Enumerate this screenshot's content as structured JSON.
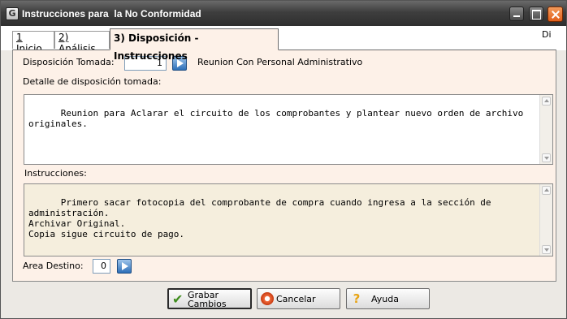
{
  "window": {
    "title": "Instrucciones para  la No Conformidad",
    "app_icon_glyph": "G"
  },
  "tabs": [
    {
      "number": "1",
      "label": "Inicio"
    },
    {
      "number": "2)",
      "label": "Análisis"
    },
    {
      "number": "3)",
      "label": "Disposición - Instrucciones"
    }
  ],
  "top_right_label": "Di",
  "form": {
    "disposicion_label": "Disposición Tomada:",
    "disposicion_value": "1",
    "disposicion_text": "Reunion Con Personal Administrativo",
    "detalle_label": "Detalle de disposición tomada:",
    "detalle_text": "Reunion para Aclarar el circuito de los comprobantes y plantear nuevo orden de archivo originales.",
    "instrucciones_label": "Instrucciones:",
    "instrucciones_text": "Primero sacar fotocopia del comprobante de compra cuando ingresa a la sección de administración.\nArchivar Original.\nCopia sigue circuito de pago.",
    "area_destino_label": "Area Destino:",
    "area_destino_value": "0"
  },
  "buttons": {
    "save_label": "Grabar Cambios",
    "cancel_label": "Cancelar",
    "help_label": "Ayuda",
    "save_icon": "check-icon",
    "cancel_icon": "cancel-icon",
    "help_icon": "question-icon"
  },
  "colors": {
    "titlebar": "#3e3e3e",
    "panel_bg": "#fdf1e8",
    "instructions_bg": "#f5eedd",
    "arrow_button": "#2d6fb8",
    "close_button": "#e25f1b"
  }
}
